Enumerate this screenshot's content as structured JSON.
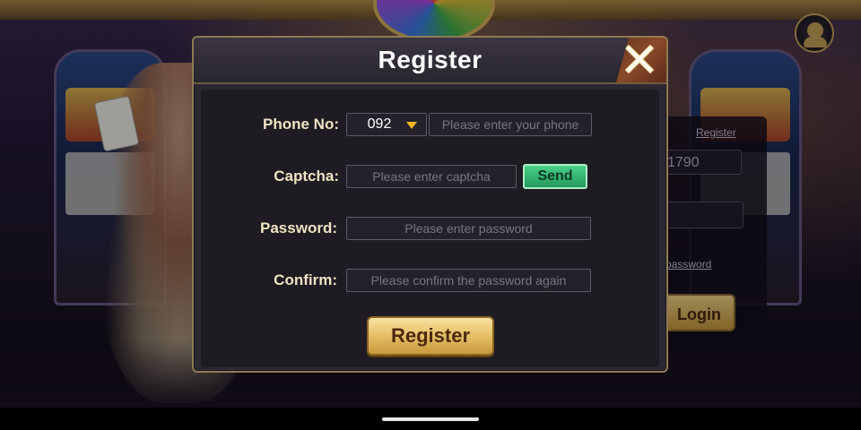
{
  "background": {
    "login_register_link": "Register",
    "login_phone_partial": "1790",
    "login_forgot_partial": "password",
    "login_button_partial": "Login"
  },
  "modal": {
    "title": "Register",
    "close_icon": "close-icon",
    "fields": {
      "phone_label": "Phone No:",
      "country_code": "092",
      "phone_placeholder": "Please enter your phone",
      "captcha_label": "Captcha:",
      "captcha_placeholder": "Please enter captcha",
      "send_label": "Send",
      "password_label": "Password:",
      "password_placeholder": "Please enter password",
      "confirm_label": "Confirm:",
      "confirm_placeholder": "Please confirm the password again"
    },
    "register_button": "Register"
  },
  "colors": {
    "accent_gold": "#e7c26a",
    "send_green": "#239a5c",
    "label_text": "#f1e3c4",
    "caret": "#f0b81e"
  }
}
